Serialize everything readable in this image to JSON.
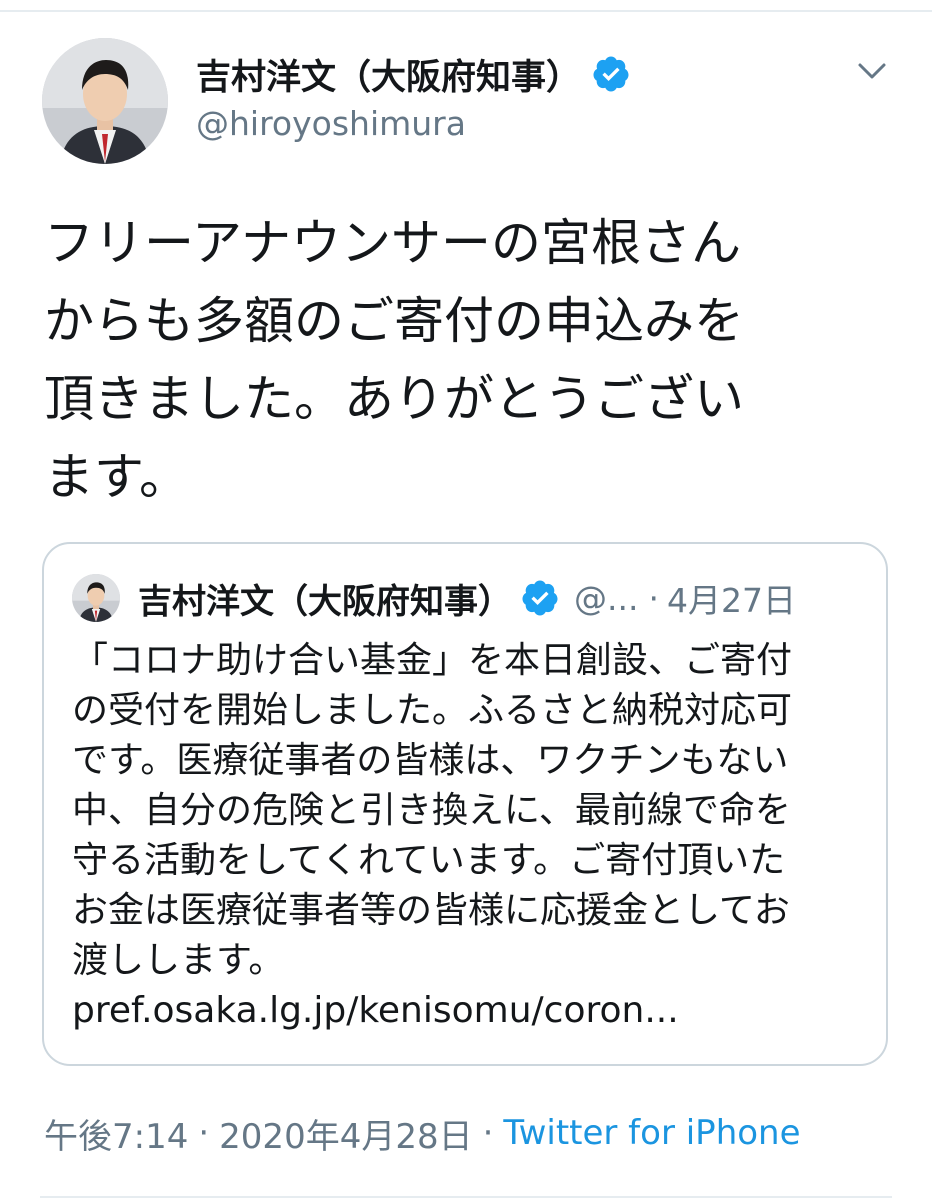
{
  "colors": {
    "text_primary": "#14171a",
    "text_secondary": "#657786",
    "link": "#1b95e0",
    "verified": "#1da1f2",
    "border": "#ccd6dd"
  },
  "author": {
    "display_name": "吉村洋文（大阪府知事）",
    "handle": "@hiroyoshimura",
    "verified_icon": "verified-badge-icon",
    "avatar_icon": "avatar-photo"
  },
  "menu": {
    "icon": "chevron-down-icon"
  },
  "tweet": {
    "text_lines": [
      "フリーアナウンサーの宮根さん",
      "からも多額のご寄付の申込みを",
      "頂きました。ありがとうござい",
      "ます。"
    ]
  },
  "quoted_tweet": {
    "display_name": "吉村洋文（大阪府知事）",
    "handle": "@...",
    "separator": "·",
    "date": "4月27日",
    "text_lines": [
      "「コロナ助け合い基金」を本日創設、ご寄付",
      "の受付を開始しました。ふるさと納税対応可",
      "です。医療従事者の皆様は、ワクチンもない",
      "中、自分の危険と引き換えに、最前線で命を",
      "守る活動をしてくれています。ご寄付頂いた",
      "お金は医療従事者等の皆様に応援金としてお",
      "渡しします。",
      "pref.osaka.lg.jp/kenisomu/coron..."
    ]
  },
  "footer": {
    "time": "午後7:14",
    "separator": "·",
    "date": "2020年4月28日",
    "source": "Twitter for iPhone"
  }
}
